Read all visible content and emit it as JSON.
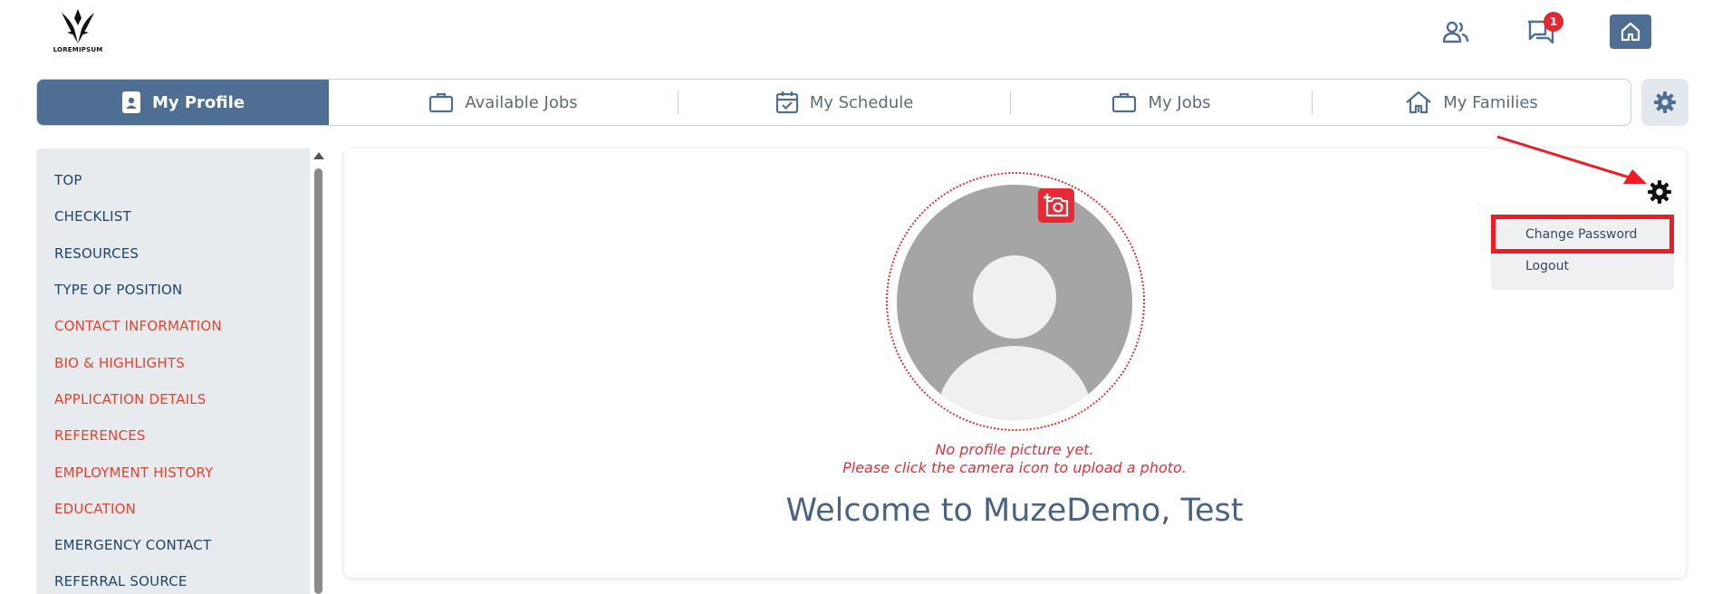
{
  "header": {
    "logo_text": "LOREMIPSUM",
    "notifications_count": "1",
    "icons": [
      "users-icon",
      "chat-icon",
      "home-icon"
    ]
  },
  "tabs": [
    {
      "label": "My Profile",
      "icon": "profile-card-icon",
      "active": true
    },
    {
      "label": "Available Jobs",
      "icon": "briefcase-icon",
      "active": false
    },
    {
      "label": "My Schedule",
      "icon": "calendar-check-icon",
      "active": false
    },
    {
      "label": "My Jobs",
      "icon": "briefcase-icon",
      "active": false
    },
    {
      "label": "My Families",
      "icon": "house-icon",
      "active": false
    }
  ],
  "sidebar": {
    "items": [
      {
        "label": "TOP",
        "status": "ok"
      },
      {
        "label": "CHECKLIST",
        "status": "ok"
      },
      {
        "label": "RESOURCES",
        "status": "ok"
      },
      {
        "label": "TYPE OF POSITION",
        "status": "ok"
      },
      {
        "label": "CONTACT INFORMATION",
        "status": "required"
      },
      {
        "label": "BIO & HIGHLIGHTS",
        "status": "required"
      },
      {
        "label": "APPLICATION DETAILS",
        "status": "required"
      },
      {
        "label": "REFERENCES",
        "status": "required"
      },
      {
        "label": "EMPLOYMENT HISTORY",
        "status": "required"
      },
      {
        "label": "EDUCATION",
        "status": "required"
      },
      {
        "label": "EMERGENCY CONTACT",
        "status": "ok"
      },
      {
        "label": "REFERRAL SOURCE",
        "status": "ok"
      }
    ]
  },
  "profile": {
    "no_picture_line1": "No profile picture yet.",
    "no_picture_line2": "Please click the camera icon to upload a photo.",
    "welcome": "Welcome to MuzeDemo, Test"
  },
  "settings_menu": {
    "items": [
      "Change Password",
      "Logout"
    ],
    "highlighted": "Change Password"
  },
  "colors": {
    "brand": "#4e6f93",
    "required": "#e04331",
    "sidebar_text": "#1f4566",
    "badge": "#e02a33",
    "annotation": "#ee1b24"
  }
}
